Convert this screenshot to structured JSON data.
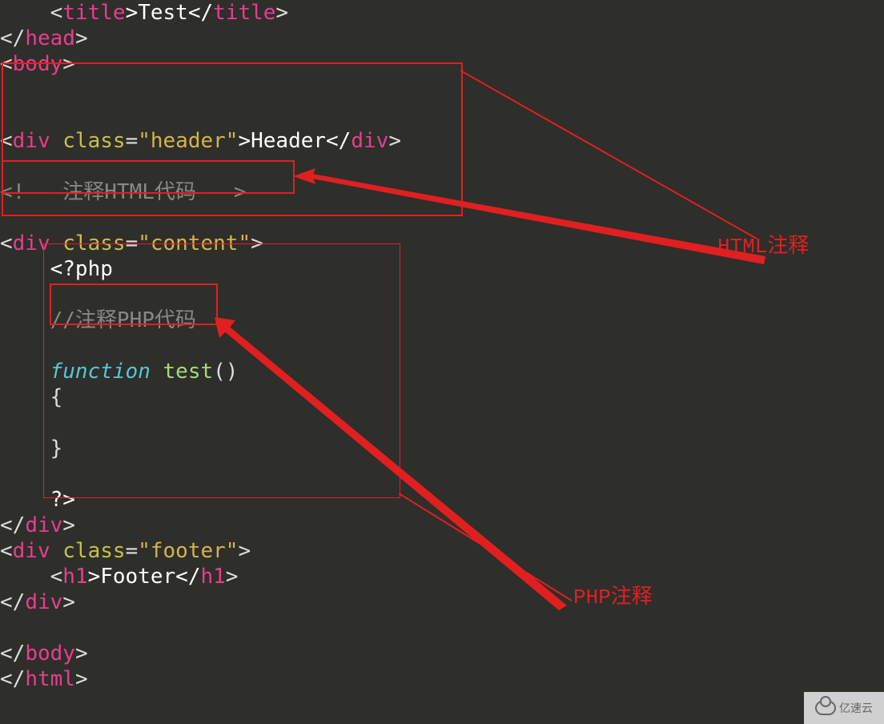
{
  "code": {
    "line1a": "<",
    "line1b": "title",
    "line1c": ">Test</",
    "line1d": "title",
    "line1e": ">",
    "line2a": "</",
    "line2b": "head",
    "line2c": ">",
    "line3a": "<",
    "line3b": "body",
    "line3c": ">",
    "line5a": "<",
    "line5b": "div",
    "line5c": " ",
    "line5d": "class",
    "line5e": "=",
    "line5f": "\"header\"",
    "line5g": ">Header</",
    "line5h": "div",
    "line5i": ">",
    "line7": "<!-- 注释HTML代码 -->",
    "line9a": "<",
    "line9b": "div",
    "line9c": " ",
    "line9d": "class",
    "line9e": "=",
    "line9f": "\"content\"",
    "line9g": ">",
    "line10": "    <?php",
    "line12": "    //注释PHP代码",
    "line14a": "    ",
    "line14b": "function",
    "line14c": " ",
    "line14d": "test",
    "line14e": "()",
    "line15": "    {",
    "line17": "    }",
    "line19": "    ?>",
    "line20a": "</",
    "line20b": "div",
    "line20c": ">",
    "line21a": "<",
    "line21b": "div",
    "line21c": " ",
    "line21d": "class",
    "line21e": "=",
    "line21f": "\"footer\"",
    "line21g": ">",
    "line22a": "    <",
    "line22b": "h1",
    "line22c": ">Footer</",
    "line22d": "h1",
    "line22e": ">",
    "line23a": "</",
    "line23b": "div",
    "line23c": ">",
    "line25a": "</",
    "line25b": "body",
    "line25c": ">",
    "line26a": "</",
    "line26b": "html",
    "line26c": ">"
  },
  "labels": {
    "html_comment": "HTML注释",
    "php_comment": "PHP注释"
  },
  "watermark": "亿速云"
}
